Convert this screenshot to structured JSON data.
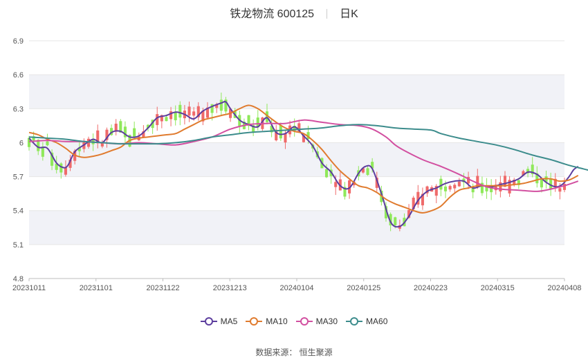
{
  "header": {
    "title": "铁龙物流 600125",
    "period": "日K"
  },
  "source_text": "数据来源： 恒生聚源",
  "colors": {
    "up": "#ef6a6a",
    "down": "#8fe85a",
    "grid": "#e6e6e6",
    "band": "#f1f2f7"
  },
  "chart_data": {
    "type": "candlestick",
    "title": "铁龙物流 600125",
    "ylim": [
      4.8,
      6.9
    ],
    "yticks": [
      "6.9",
      "6.6",
      "6.3",
      "6",
      "5.7",
      "5.4",
      "5.1",
      "4.8"
    ],
    "xticks": [
      "20231011",
      "20231101",
      "20231122",
      "20231213",
      "20240104",
      "20240125",
      "20240223",
      "20240315",
      "20240408"
    ],
    "n_bars": 118,
    "grid": true,
    "legend_position": "bottom",
    "series": [
      {
        "name": "MA5",
        "color": "#5c3d9e",
        "points": [
          [
            0,
            6.04
          ],
          [
            4,
            5.96
          ],
          [
            8,
            5.95
          ],
          [
            12,
            5.82
          ],
          [
            15,
            5.78
          ],
          [
            17,
            5.8
          ],
          [
            20,
            5.92
          ],
          [
            24,
            5.98
          ],
          [
            28,
            6.03
          ],
          [
            32,
            6.0
          ],
          [
            36,
            6.09
          ],
          [
            40,
            6.1
          ],
          [
            44,
            6.05
          ],
          [
            48,
            6.06
          ],
          [
            52,
            6.13
          ],
          [
            56,
            6.22
          ],
          [
            60,
            6.24
          ],
          [
            64,
            6.27
          ],
          [
            68,
            6.25
          ],
          [
            72,
            6.21
          ],
          [
            76,
            6.28
          ],
          [
            80,
            6.32
          ],
          [
            84,
            6.35
          ],
          [
            86,
            6.36
          ],
          [
            88,
            6.3
          ],
          [
            92,
            6.2
          ],
          [
            96,
            6.16
          ],
          [
            100,
            6.14
          ],
          [
            104,
            6.22
          ],
          [
            108,
            6.09
          ],
          [
            112,
            6.08
          ],
          [
            116,
            6.14
          ],
          [
            120,
            6.06
          ],
          [
            124,
            5.97
          ],
          [
            128,
            5.82
          ],
          [
            132,
            5.74
          ],
          [
            136,
            5.62
          ],
          [
            140,
            5.6
          ],
          [
            144,
            5.73
          ],
          [
            147,
            5.79
          ],
          [
            150,
            5.77
          ],
          [
            154,
            5.55
          ],
          [
            158,
            5.3
          ],
          [
            162,
            5.26
          ],
          [
            166,
            5.35
          ],
          [
            170,
            5.49
          ],
          [
            174,
            5.57
          ],
          [
            178,
            5.6
          ],
          [
            182,
            5.64
          ],
          [
            186,
            5.66
          ],
          [
            190,
            5.66
          ],
          [
            194,
            5.6
          ],
          [
            198,
            5.62
          ],
          [
            202,
            5.61
          ],
          [
            206,
            5.63
          ],
          [
            210,
            5.65
          ],
          [
            214,
            5.68
          ],
          [
            218,
            5.74
          ],
          [
            222,
            5.72
          ],
          [
            226,
            5.65
          ],
          [
            230,
            5.61
          ],
          [
            233,
            5.63
          ],
          [
            236,
            5.7
          ],
          [
            238,
            5.76
          ],
          [
            240,
            5.79
          ]
        ]
      },
      {
        "name": "MA10",
        "color": "#e07b2e",
        "points": [
          [
            0,
            6.09
          ],
          [
            4,
            6.07
          ],
          [
            8,
            6.03
          ],
          [
            12,
            6.0
          ],
          [
            16,
            5.95
          ],
          [
            20,
            5.89
          ],
          [
            24,
            5.87
          ],
          [
            28,
            5.88
          ],
          [
            32,
            5.9
          ],
          [
            36,
            5.93
          ],
          [
            40,
            5.96
          ],
          [
            44,
            6.02
          ],
          [
            48,
            6.04
          ],
          [
            52,
            6.05
          ],
          [
            56,
            6.06
          ],
          [
            60,
            6.07
          ],
          [
            64,
            6.08
          ],
          [
            68,
            6.12
          ],
          [
            72,
            6.16
          ],
          [
            76,
            6.2
          ],
          [
            80,
            6.22
          ],
          [
            84,
            6.24
          ],
          [
            88,
            6.26
          ],
          [
            92,
            6.3
          ],
          [
            96,
            6.33
          ],
          [
            100,
            6.3
          ],
          [
            104,
            6.24
          ],
          [
            108,
            6.18
          ],
          [
            112,
            6.13
          ],
          [
            116,
            6.1
          ],
          [
            120,
            6.08
          ],
          [
            124,
            6.02
          ],
          [
            128,
            5.94
          ],
          [
            132,
            5.84
          ],
          [
            136,
            5.75
          ],
          [
            140,
            5.68
          ],
          [
            144,
            5.62
          ],
          [
            148,
            5.6
          ],
          [
            152,
            5.56
          ],
          [
            156,
            5.5
          ],
          [
            160,
            5.46
          ],
          [
            164,
            5.43
          ],
          [
            168,
            5.4
          ],
          [
            172,
            5.38
          ],
          [
            176,
            5.4
          ],
          [
            180,
            5.44
          ],
          [
            184,
            5.52
          ],
          [
            188,
            5.58
          ],
          [
            192,
            5.6
          ],
          [
            196,
            5.62
          ],
          [
            200,
            5.62
          ],
          [
            204,
            5.62
          ],
          [
            208,
            5.62
          ],
          [
            212,
            5.63
          ],
          [
            216,
            5.64
          ],
          [
            220,
            5.66
          ],
          [
            224,
            5.68
          ],
          [
            228,
            5.68
          ],
          [
            232,
            5.66
          ],
          [
            236,
            5.67
          ],
          [
            240,
            5.71
          ]
        ]
      },
      {
        "name": "MA30",
        "color": "#d24fa0",
        "points": [
          [
            0,
            6.01
          ],
          [
            8,
            6.02
          ],
          [
            16,
            6.01
          ],
          [
            24,
            6.01
          ],
          [
            32,
            6.0
          ],
          [
            40,
            5.99
          ],
          [
            48,
            6.0
          ],
          [
            56,
            5.99
          ],
          [
            64,
            5.98
          ],
          [
            72,
            6.01
          ],
          [
            80,
            6.05
          ],
          [
            88,
            6.12
          ],
          [
            96,
            6.16
          ],
          [
            104,
            6.17
          ],
          [
            112,
            6.17
          ],
          [
            120,
            6.2
          ],
          [
            128,
            6.18
          ],
          [
            136,
            6.16
          ],
          [
            144,
            6.15
          ],
          [
            150,
            6.12
          ],
          [
            156,
            6.05
          ],
          [
            160,
            5.98
          ],
          [
            164,
            5.93
          ],
          [
            172,
            5.85
          ],
          [
            180,
            5.79
          ],
          [
            188,
            5.72
          ],
          [
            194,
            5.66
          ],
          [
            200,
            5.61
          ],
          [
            206,
            5.59
          ],
          [
            214,
            5.58
          ],
          [
            222,
            5.57
          ],
          [
            228,
            5.59
          ],
          [
            234,
            5.62
          ],
          [
            240,
            5.66
          ]
        ]
      },
      {
        "name": "MA60",
        "color": "#3c8c8c",
        "points": [
          [
            0,
            6.05
          ],
          [
            8,
            6.04
          ],
          [
            16,
            6.03
          ],
          [
            24,
            6.01
          ],
          [
            32,
            6.0
          ],
          [
            40,
            5.99
          ],
          [
            48,
            5.99
          ],
          [
            56,
            5.99
          ],
          [
            64,
            6.0
          ],
          [
            72,
            6.02
          ],
          [
            80,
            6.05
          ],
          [
            88,
            6.07
          ],
          [
            96,
            6.09
          ],
          [
            104,
            6.1
          ],
          [
            112,
            6.11
          ],
          [
            120,
            6.12
          ],
          [
            128,
            6.13
          ],
          [
            136,
            6.15
          ],
          [
            144,
            6.16
          ],
          [
            152,
            6.15
          ],
          [
            160,
            6.13
          ],
          [
            168,
            6.12
          ],
          [
            176,
            6.11
          ],
          [
            180,
            6.08
          ],
          [
            188,
            6.04
          ],
          [
            196,
            6.01
          ],
          [
            204,
            5.98
          ],
          [
            212,
            5.94
          ],
          [
            220,
            5.89
          ],
          [
            228,
            5.85
          ],
          [
            236,
            5.8
          ],
          [
            240,
            5.78
          ],
          [
            246,
            5.75
          ],
          [
            252,
            5.73
          ],
          [
            258,
            5.72
          ],
          [
            262,
            5.72
          ]
        ]
      }
    ]
  }
}
